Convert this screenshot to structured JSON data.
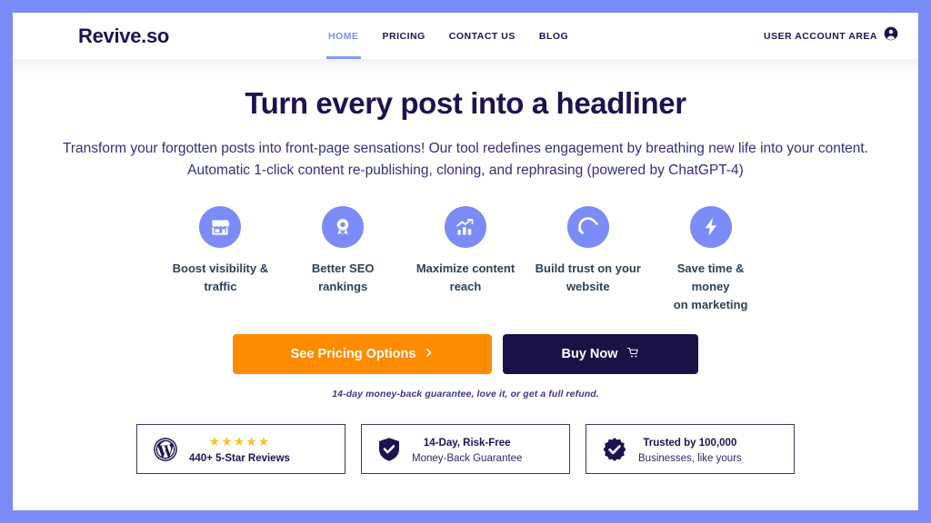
{
  "colors": {
    "page_border": "#7b8cf8",
    "brand_navy": "#1b1452",
    "accent_periwinkle": "#7b8cf8",
    "cta_orange": "#ff8c00",
    "cta_navy": "#191246",
    "star_gold": "#f6c32a"
  },
  "header": {
    "logo": "Revive.so",
    "nav": [
      {
        "label": "HOME",
        "active": true
      },
      {
        "label": "PRICING",
        "active": false
      },
      {
        "label": "CONTACT US",
        "active": false
      },
      {
        "label": "BLOG",
        "active": false
      }
    ],
    "account": {
      "label": "USER ACCOUNT AREA",
      "icon": "user-circle-icon"
    }
  },
  "hero": {
    "headline": "Turn every post into a headliner",
    "subhead_line1": "Transform your forgotten posts into front-page sensations! Our tool redefines engagement by breathing new life into your content.",
    "subhead_line2": "Automatic 1-click content re-publishing, cloning, and rephrasing (powered by ChatGPT-4)"
  },
  "features": [
    {
      "icon": "storefront-icon",
      "label_line1": "Boost visibility &",
      "label_line2": "traffic"
    },
    {
      "icon": "award-medal-icon",
      "label_line1": "Better SEO",
      "label_line2": "rankings"
    },
    {
      "icon": "bar-chart-growth-icon",
      "label_line1": "Maximize content",
      "label_line2": "reach"
    },
    {
      "icon": "magnet-icon",
      "label_line1": "Build trust on your",
      "label_line2": "website"
    },
    {
      "icon": "lightning-bolt-icon",
      "label_line1": "Save time & money",
      "label_line2": "on marketing"
    }
  ],
  "cta": {
    "pricing_label": "See Pricing Options",
    "pricing_icon": "chevron-right-icon",
    "buy_label": "Buy Now",
    "buy_icon": "shopping-cart-icon",
    "guarantee": "14-day money-back guarantee, love it, or get a full refund."
  },
  "trust_badges": [
    {
      "icon": "wordpress-logo-icon",
      "stars": "★★★★★",
      "title": "440+ 5-Star Reviews",
      "sub": ""
    },
    {
      "icon": "shield-check-icon",
      "stars": "",
      "title": "14-Day, Risk-Free",
      "sub": "Money-Back Guarantee"
    },
    {
      "icon": "verified-badge-icon",
      "stars": "",
      "title": "Trusted by 100,000",
      "sub": "Businesses, like yours"
    }
  ]
}
